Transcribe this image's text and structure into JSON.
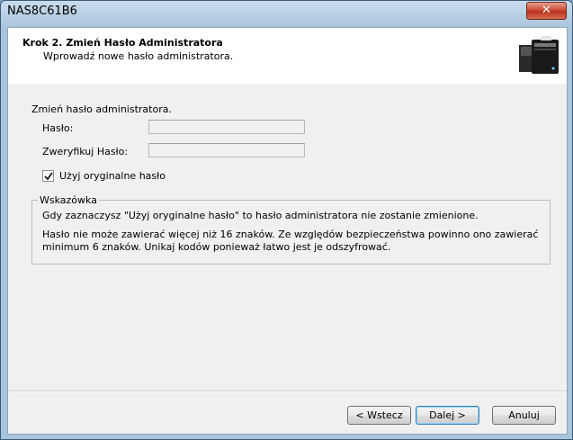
{
  "window": {
    "title": "NAS8C61B6",
    "close_label": "✕"
  },
  "header": {
    "title": "Krok 2. Zmień Hasło Administratora",
    "subtitle": "Wprowadź nowe hasło administratora."
  },
  "form": {
    "section_label": "Zmień hasło administratora.",
    "password_label": "Hasło:",
    "password_value": "",
    "confirm_label": "Zweryfikuj Hasło:",
    "confirm_value": "",
    "use_original_label": "Użyj oryginalne hasło",
    "use_original_checked": true
  },
  "hints": {
    "legend": "Wskazówka",
    "line1": "Gdy zaznaczysz \"Użyj oryginalne hasło\" to hasło administratora nie zostanie zmienione.",
    "line2": "Hasło nie może zawierać więcej niż 16 znaków. Ze względów bezpieczeństwa powinno ono zawierać minimum 6 znaków. Unikaj kodów ponieważ łatwo jest je odszyfrować."
  },
  "buttons": {
    "back": "< Wstecz",
    "next": "Dalej >",
    "cancel": "Anuluj"
  }
}
